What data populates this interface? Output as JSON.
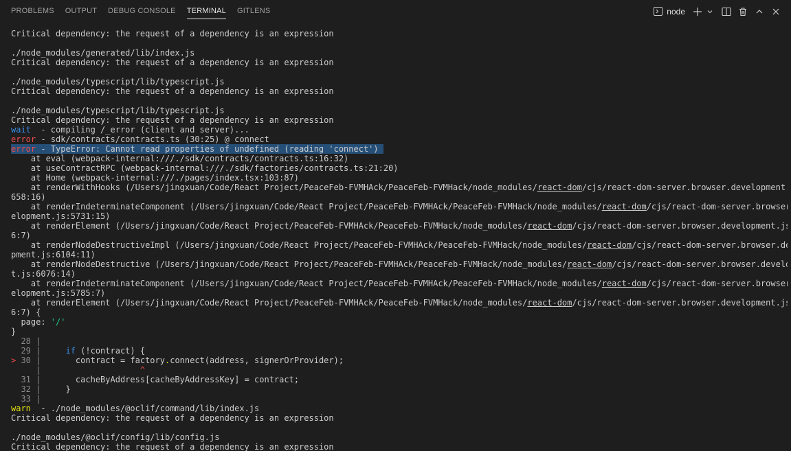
{
  "tabs": [
    {
      "label": "PROBLEMS"
    },
    {
      "label": "OUTPUT"
    },
    {
      "label": "DEBUG CONSOLE"
    },
    {
      "label": "TERMINAL",
      "active": true
    },
    {
      "label": "GITLENS"
    }
  ],
  "terminal_selector": {
    "name": "node",
    "icon": "terminal-icon"
  },
  "actions": [
    "add-icon",
    "chevron-down-icon",
    "split-icon",
    "trash-icon",
    "chevron-up-icon",
    "close-icon"
  ],
  "colors": {
    "background": "#1e1e1e",
    "wait": "#3b8eea",
    "error": "#f14c4c",
    "warn": "#e5e510",
    "string": "#23d18b",
    "selection": "#264f78"
  },
  "log": {
    "l1": "Critical dependency: the request of a dependency is an expression",
    "l2": "",
    "l3": "./node_modules/generated/lib/index.js",
    "l4": "Critical dependency: the request of a dependency is an expression",
    "l5": "",
    "l6": "./node_modules/typescript/lib/typescript.js",
    "l7": "Critical dependency: the request of a dependency is an expression",
    "l8": "",
    "l9": "./node_modules/typescript/lib/typescript.js",
    "l10": "Critical dependency: the request of a dependency is an expression",
    "wait_tag": "wait",
    "wait_msg": "  - compiling /_error (client and server)...",
    "error1_tag": "error",
    "error1_msg": " - sdk/contracts/contracts.ts (30:25) @ connect",
    "error2_tag": "error",
    "error2_msg": " - TypeError: Cannot read properties of undefined (reading 'connect')",
    "s1": "    at eval (webpack-internal:///./sdk/contracts/contracts.ts:16:32)",
    "s2": "    at useContractRPC (webpack-internal:///./sdk/factories/contracts.ts:21:20)",
    "s3": "    at Home (webpack-internal:///./pages/index.tsx:103:87)",
    "s4a": "    at renderWithHooks (/Users/jingxuan/Code/React Project/PeaceFeb-FVMHAck/PeaceFeb-FVMHack/node_modules/",
    "s4b": "react-dom",
    "s4c": "/cjs/react-dom-server.browser.development.js:5",
    "s4d": "658:16)",
    "s5a": "    at renderIndeterminateComponent (/Users/jingxuan/Code/React Project/PeaceFeb-FVMHAck/PeaceFeb-FVMHack/node_modules/",
    "s5b": "react-dom",
    "s5c": "/cjs/react-dom-server.browser.dev",
    "s5d": "elopment.js:5731:15)",
    "s6a": "    at renderElement (/Users/jingxuan/Code/React Project/PeaceFeb-FVMHAck/PeaceFeb-FVMHack/node_modules/",
    "s6b": "react-dom",
    "s6c": "/cjs/react-dom-server.browser.development.js:594",
    "s6d": "6:7)",
    "s7a": "    at renderNodeDestructiveImpl (/Users/jingxuan/Code/React Project/PeaceFeb-FVMHAck/PeaceFeb-FVMHack/node_modules/",
    "s7b": "react-dom",
    "s7c": "/cjs/react-dom-server.browser.develo",
    "s7d": "pment.js:6104:11)",
    "s8a": "    at renderNodeDestructive (/Users/jingxuan/Code/React Project/PeaceFeb-FVMHAck/PeaceFeb-FVMHack/node_modules/",
    "s8b": "react-dom",
    "s8c": "/cjs/react-dom-server.browser.developmen",
    "s8d": "t.js:6076:14)",
    "s9a": "    at renderIndeterminateComponent (/Users/jingxuan/Code/React Project/PeaceFeb-FVMHAck/PeaceFeb-FVMHack/node_modules/",
    "s9b": "react-dom",
    "s9c": "/cjs/react-dom-server.browser.dev",
    "s9d": "elopment.js:5785:7)",
    "s10a": "    at renderElement (/Users/jingxuan/Code/React Project/PeaceFeb-FVMHAck/PeaceFeb-FVMHack/node_modules/",
    "s10b": "react-dom",
    "s10c": "/cjs/react-dom-server.browser.development.js:594",
    "s10d": "6:7) {",
    "page_key": "  page: ",
    "page_val": "'/'",
    "close_brace": "}",
    "c28": "  28 |",
    "c29_num": "  29 |",
    "c29_pre": "     ",
    "c29_kw": "if",
    "c29_rest": " (!contract) {",
    "c30_marker": ">",
    "c30_num": " 30 |",
    "c30_a": "       contract = factory",
    "c30_dot": ".",
    "c30_b": "connect(address, signerOrProvider);",
    "c_caret_bar": "     |",
    "c_caret_pad": "                    ",
    "c_caret": "^",
    "c31_num": "  31 |",
    "c31_code": "       cacheByAddress[cacheByAddressKey] = contract;",
    "c32_num": "  32 |",
    "c32_code": "     }",
    "c33": "  33 |",
    "warn_tag": "warn",
    "warn_msg": "  - ./node_modules/@oclif/command/lib/index.js",
    "l11": "Critical dependency: the request of a dependency is an expression",
    "l12": "",
    "l13": "./node_modules/@oclif/config/lib/config.js",
    "l14": "Critical dependency: the request of a dependency is an expression"
  }
}
